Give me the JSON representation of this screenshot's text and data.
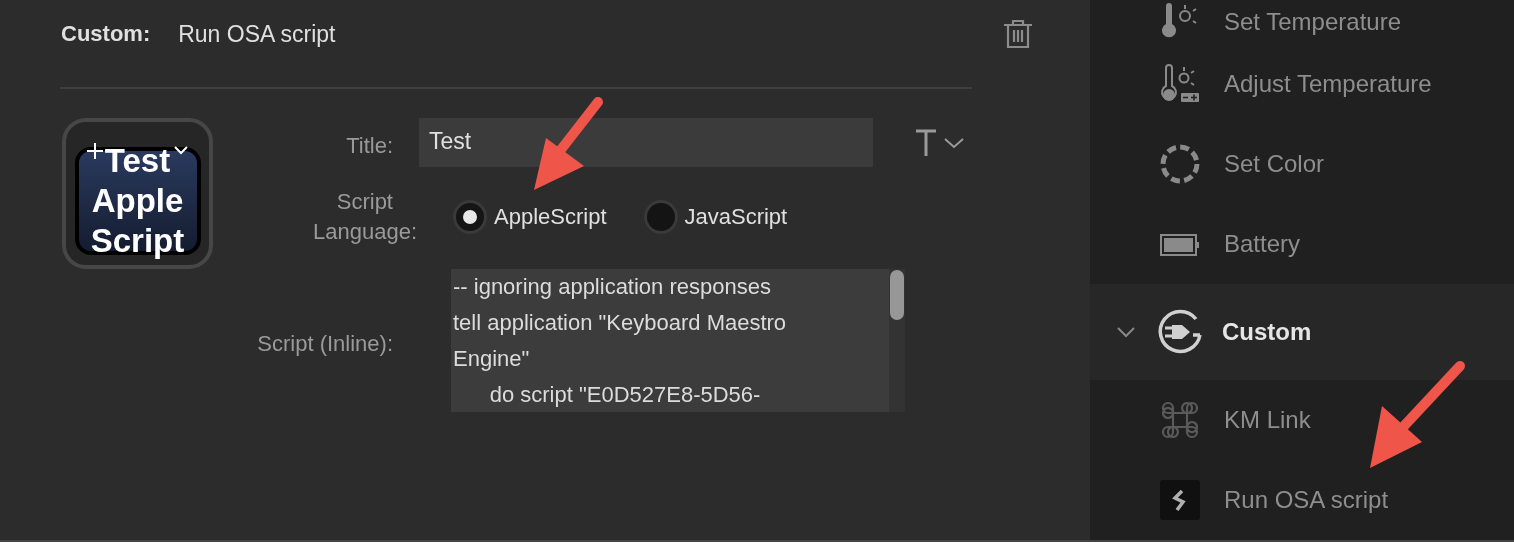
{
  "header": {
    "label": "Custom:",
    "title": "Run OSA script"
  },
  "icon_preview": {
    "text": "Test Apple Script"
  },
  "form": {
    "title_label": "Title:",
    "title_value": "Test",
    "language_label": "Script Language:",
    "languages": [
      {
        "label": "AppleScript",
        "selected": true
      },
      {
        "label": "JavaScript",
        "selected": false
      }
    ],
    "script_label": "Script (Inline):",
    "script_lines": [
      "-- ignoring application responses",
      "tell application \"Keyboard Maestro Engine\"",
      "\tdo script \"E0D527E8-5D56-"
    ]
  },
  "sidebar": {
    "items": [
      {
        "kind": "item",
        "label": "Set Temperature"
      },
      {
        "kind": "item",
        "label": "Adjust Temperature"
      },
      {
        "kind": "item",
        "label": "Set Color"
      },
      {
        "kind": "item",
        "label": "Battery"
      },
      {
        "kind": "group",
        "label": "Custom",
        "expanded": true
      },
      {
        "kind": "item",
        "label": "KM Link"
      },
      {
        "kind": "item",
        "label": "Run OSA script"
      }
    ]
  }
}
